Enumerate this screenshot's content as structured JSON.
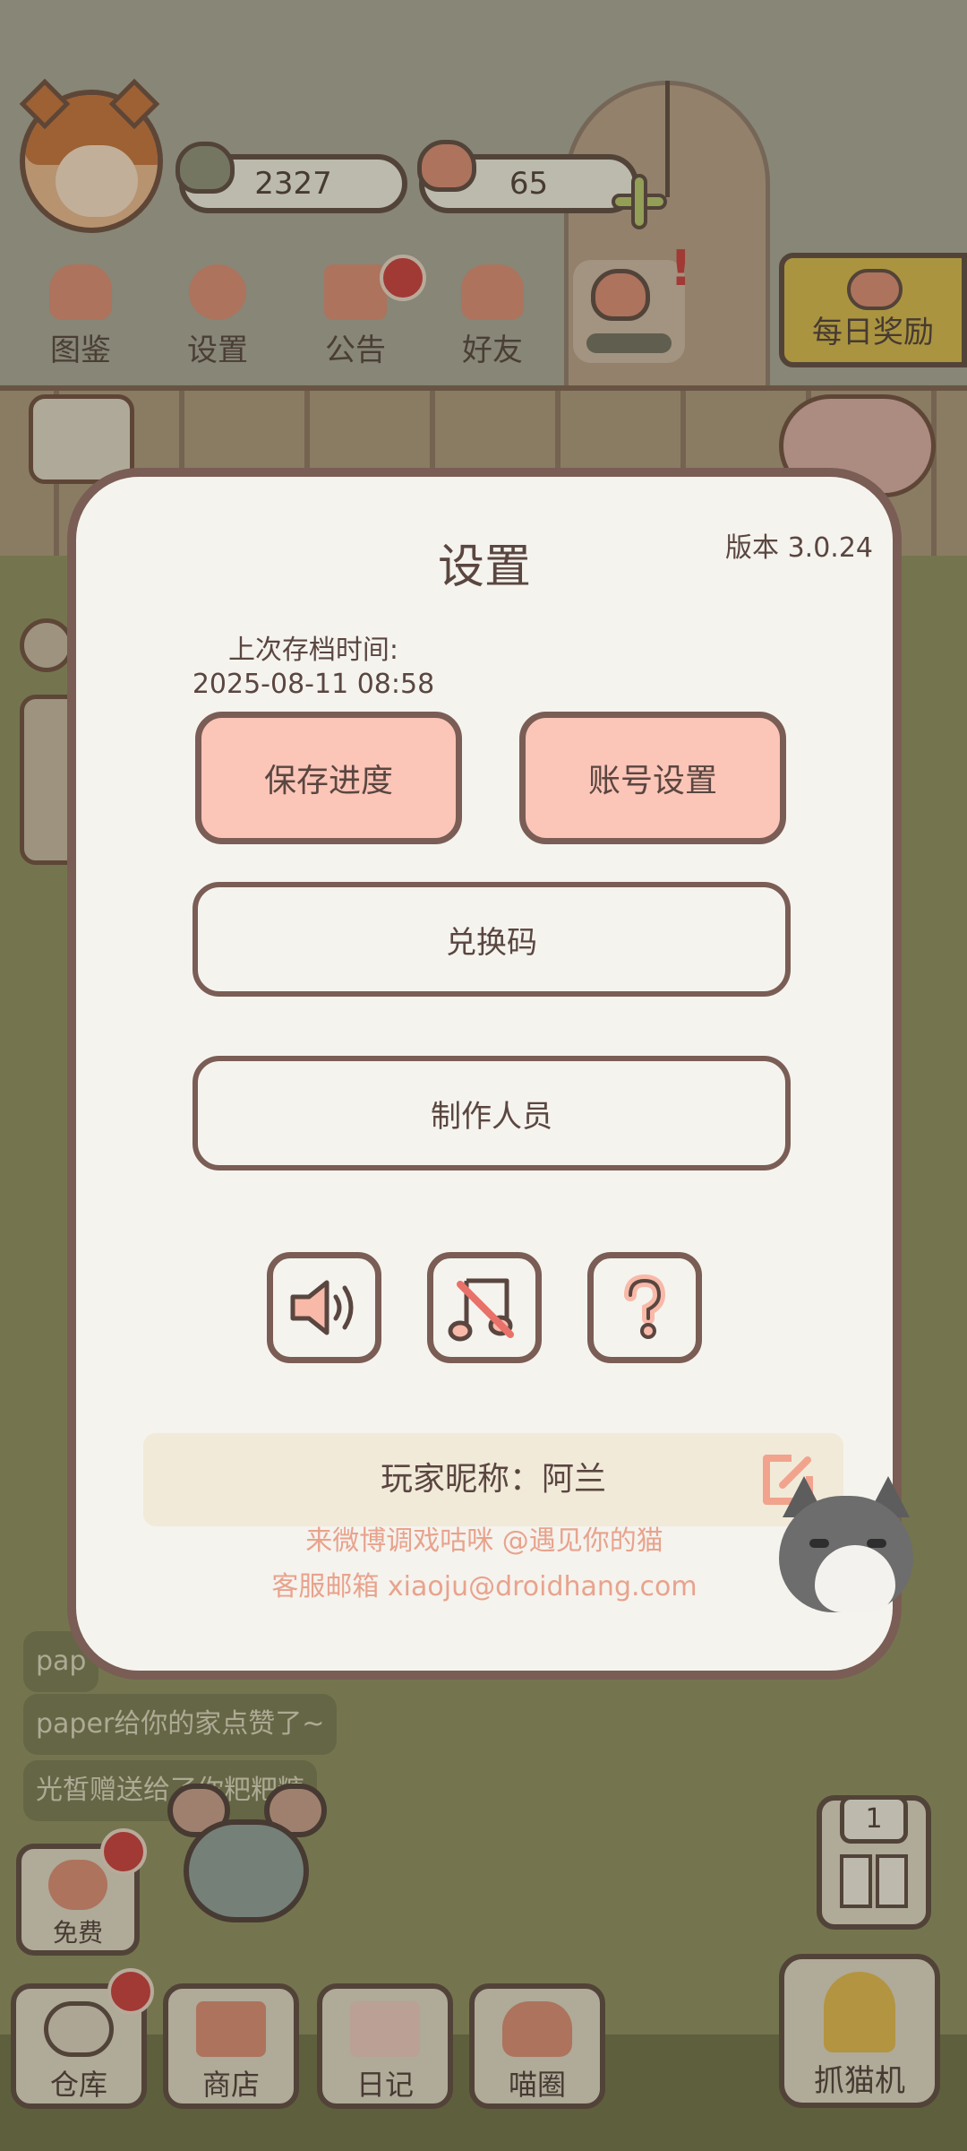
{
  "hud": {
    "fish_count": "2327",
    "heart_count": "65"
  },
  "top_menu": [
    {
      "label": "图鉴",
      "icon": "cat-head-book-icon"
    },
    {
      "label": "设置",
      "icon": "gear-icon"
    },
    {
      "label": "公告",
      "icon": "gift-icon"
    },
    {
      "label": "好友",
      "icon": "friends-icon"
    }
  ],
  "daily_reward": {
    "label": "每日奖励",
    "icon": "heart-fish-icon"
  },
  "chat": [
    "pap",
    "paper给你的家点赞了~",
    "光皙赠送给了你粑粑糖"
  ],
  "bottom_nav": {
    "free": "免费",
    "storage": "仓库",
    "shop": "商店",
    "diary": "日记",
    "circle": "喵圈",
    "claw": "抓猫机",
    "floor": "1"
  },
  "dialog": {
    "title": "设置",
    "version": "版本 3.0.24",
    "last_save_label": "上次存档时间:",
    "last_save_time": "2025-08-11 08:58",
    "save_button": "保存进度",
    "account_button": "账号设置",
    "redeem_button": "兑换码",
    "credits_button": "制作人员",
    "icons": [
      "speaker-icon",
      "music-muted-icon",
      "help-icon"
    ],
    "nickname": "玩家昵称：阿兰",
    "weibo": "来微博调戏咕咪 @遇见你的猫",
    "email": "客服邮箱 xiaoju@droidhang.com"
  },
  "colors": {
    "accent_pink": "#fbc5b8",
    "border_brown": "#7a5d55",
    "link_salmon": "#e8a38d",
    "dialog_bg": "#f5f3ee",
    "badge_red": "#c8393a"
  }
}
